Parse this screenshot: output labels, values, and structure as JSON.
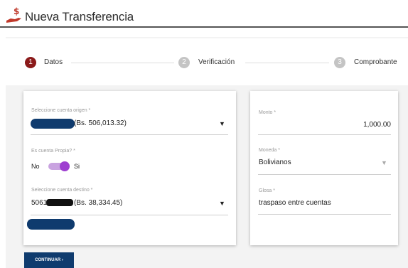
{
  "header": {
    "title": "Nueva Transferencia",
    "icon": "hand-money-icon"
  },
  "stepper": {
    "steps": [
      {
        "number": "1",
        "label": "Datos",
        "active": true
      },
      {
        "number": "2",
        "label": "Verificación",
        "active": false
      },
      {
        "number": "3",
        "label": "Comprobante",
        "active": false
      }
    ]
  },
  "form": {
    "origin": {
      "label": "Seleccione cuenta origen *",
      "value": "(Bs. 506,013.32)",
      "redacted": true
    },
    "own_account": {
      "label": "Es cuenta Propia? *",
      "no_label": "No",
      "yes_label": "Si",
      "value": true
    },
    "destination": {
      "label": "Seleccione cuenta destino *",
      "value_prefix": "5061",
      "value_suffix": "(Bs. 38,334.45)",
      "redacted": true
    },
    "amount": {
      "label": "Monto *",
      "value": "1,000.00"
    },
    "currency": {
      "label": "Moneda *",
      "value": "Bolivianos"
    },
    "memo": {
      "label": "Glosa *",
      "value": "traspaso entre cuentas"
    }
  },
  "buttons": {
    "continue_label": "CONTINUAR"
  },
  "colors": {
    "active_step": "#8b1a1a",
    "inactive_step": "#c4c4c4",
    "toggle_on": "#9e3fd0",
    "primary": "#0f3b6e",
    "logo": "#c0392b"
  }
}
